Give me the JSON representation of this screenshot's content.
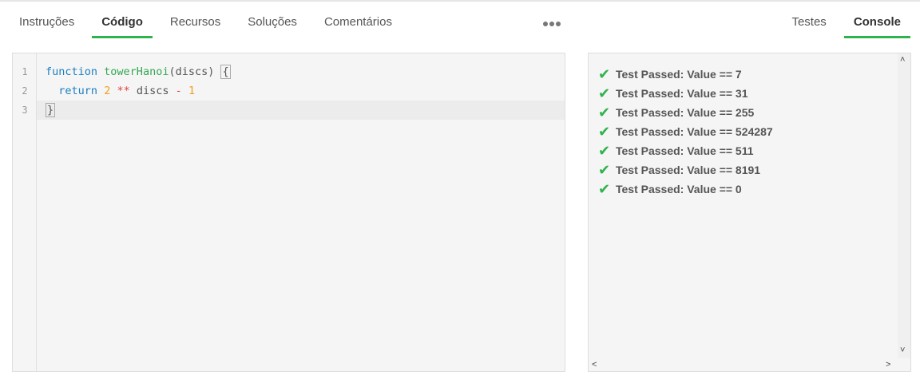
{
  "tabs_left": [
    "Instruções",
    "Código",
    "Recursos",
    "Soluções",
    "Comentários"
  ],
  "active_left_tab": "Código",
  "tabs_right": [
    "Testes",
    "Console"
  ],
  "active_right_tab": "Console",
  "more_icon": "more-dots-icon",
  "editor": {
    "line_numbers": [
      "1",
      "2",
      "3"
    ],
    "line1": {
      "kw": "function",
      "fn": "towerHanoi",
      "args": "(discs) ",
      "brace": "{"
    },
    "line2": {
      "indent": "  ",
      "kw": "return",
      "n1": "2",
      "op": "**",
      "var": "discs",
      "minus": "-",
      "n2": "1"
    },
    "line3": {
      "brace": "}"
    }
  },
  "console": {
    "results": [
      "Test Passed: Value == 7",
      "Test Passed: Value == 31",
      "Test Passed: Value == 255",
      "Test Passed: Value == 524287",
      "Test Passed: Value == 511",
      "Test Passed: Value == 8191",
      "Test Passed: Value == 0"
    ],
    "check_icon": "check-icon",
    "check_color": "#2fb34d"
  },
  "accent_color": "#2fb34d"
}
